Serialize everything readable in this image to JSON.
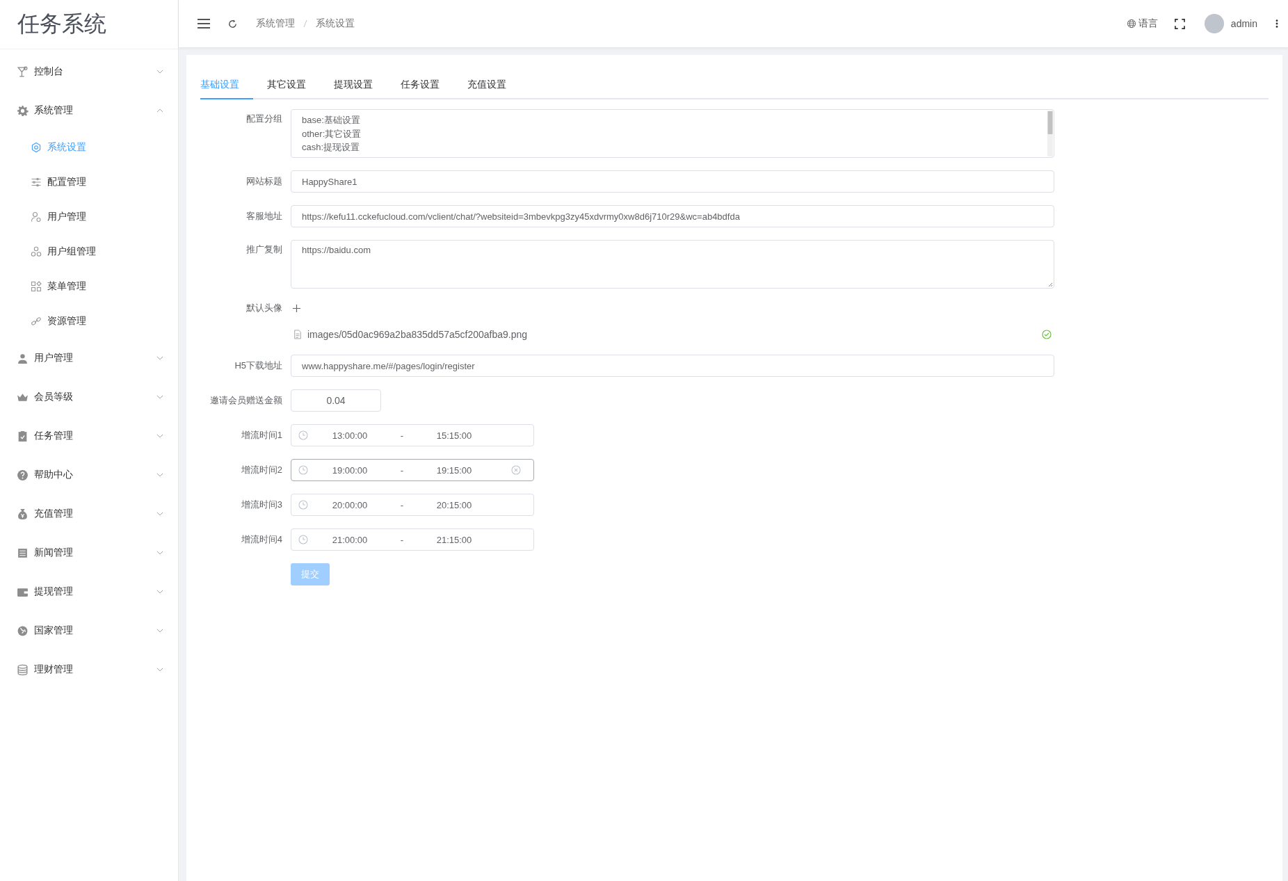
{
  "app": {
    "title": "任务系统"
  },
  "sidebar": {
    "items": [
      {
        "label": "控制台",
        "expanded": false
      },
      {
        "label": "系统管理",
        "expanded": true,
        "children": [
          {
            "label": "系统设置",
            "selected": true
          },
          {
            "label": "配置管理",
            "selected": false
          },
          {
            "label": "用户管理",
            "selected": false
          },
          {
            "label": "用户组管理",
            "selected": false
          },
          {
            "label": "菜单管理",
            "selected": false
          },
          {
            "label": "资源管理",
            "selected": false
          }
        ]
      },
      {
        "label": "用户管理",
        "expanded": false
      },
      {
        "label": "会员等级",
        "expanded": false
      },
      {
        "label": "任务管理",
        "expanded": false
      },
      {
        "label": "帮助中心",
        "expanded": false
      },
      {
        "label": "充值管理",
        "expanded": false
      },
      {
        "label": "新闻管理",
        "expanded": false
      },
      {
        "label": "提现管理",
        "expanded": false
      },
      {
        "label": "国家管理",
        "expanded": false
      },
      {
        "label": "理财管理",
        "expanded": false
      }
    ]
  },
  "header": {
    "breadcrumb": [
      "系统管理",
      "系统设置"
    ],
    "language": "语言",
    "user": "admin"
  },
  "tabs": [
    {
      "label": "基础设置",
      "selected": true
    },
    {
      "label": "其它设置",
      "selected": false
    },
    {
      "label": "提现设置",
      "selected": false
    },
    {
      "label": "任务设置",
      "selected": false
    },
    {
      "label": "充值设置",
      "selected": false
    }
  ],
  "form": {
    "fields": [
      {
        "kind": "list",
        "label": "配置分组",
        "lines": [
          "base:基础设置",
          "other:其它设置",
          "cash:提现设置"
        ]
      },
      {
        "kind": "input",
        "label": "网站标题",
        "value": "HappyShare1"
      },
      {
        "kind": "input",
        "label": "客服地址",
        "value": "https://kefu11.cckefucloud.com/vclient/chat/?websiteid=3mbevkpg3zy45xdvrmy0xw8d6j710r29&wc=ab4bdfda"
      },
      {
        "kind": "textarea",
        "label": "推广复制",
        "value": "https://baidu.com"
      },
      {
        "kind": "upload",
        "label": "默认头像",
        "file": "images/05d0ac969a2ba835dd57a5cf200afba9.png",
        "uploaded": true
      },
      {
        "kind": "input",
        "label": "H5下载地址",
        "value": "www.happyshare.me/#/pages/login/register"
      },
      {
        "kind": "amount",
        "label": "邀请会员赠送金额",
        "value": "0.04"
      },
      {
        "kind": "time",
        "label": "增流时间1",
        "start": "13:00:00",
        "separator": "-",
        "end": "15:15:00",
        "hovered": false
      },
      {
        "kind": "time",
        "label": "增流时间2",
        "start": "19:00:00",
        "separator": "-",
        "end": "19:15:00",
        "hovered": true
      },
      {
        "kind": "time",
        "label": "增流时间3",
        "start": "20:00:00",
        "separator": "-",
        "end": "20:15:00",
        "hovered": false
      },
      {
        "kind": "time",
        "label": "增流时间4",
        "start": "21:00:00",
        "separator": "-",
        "end": "21:15:00",
        "hovered": false
      }
    ],
    "submit": {
      "label": "提交",
      "disabled": true
    }
  }
}
